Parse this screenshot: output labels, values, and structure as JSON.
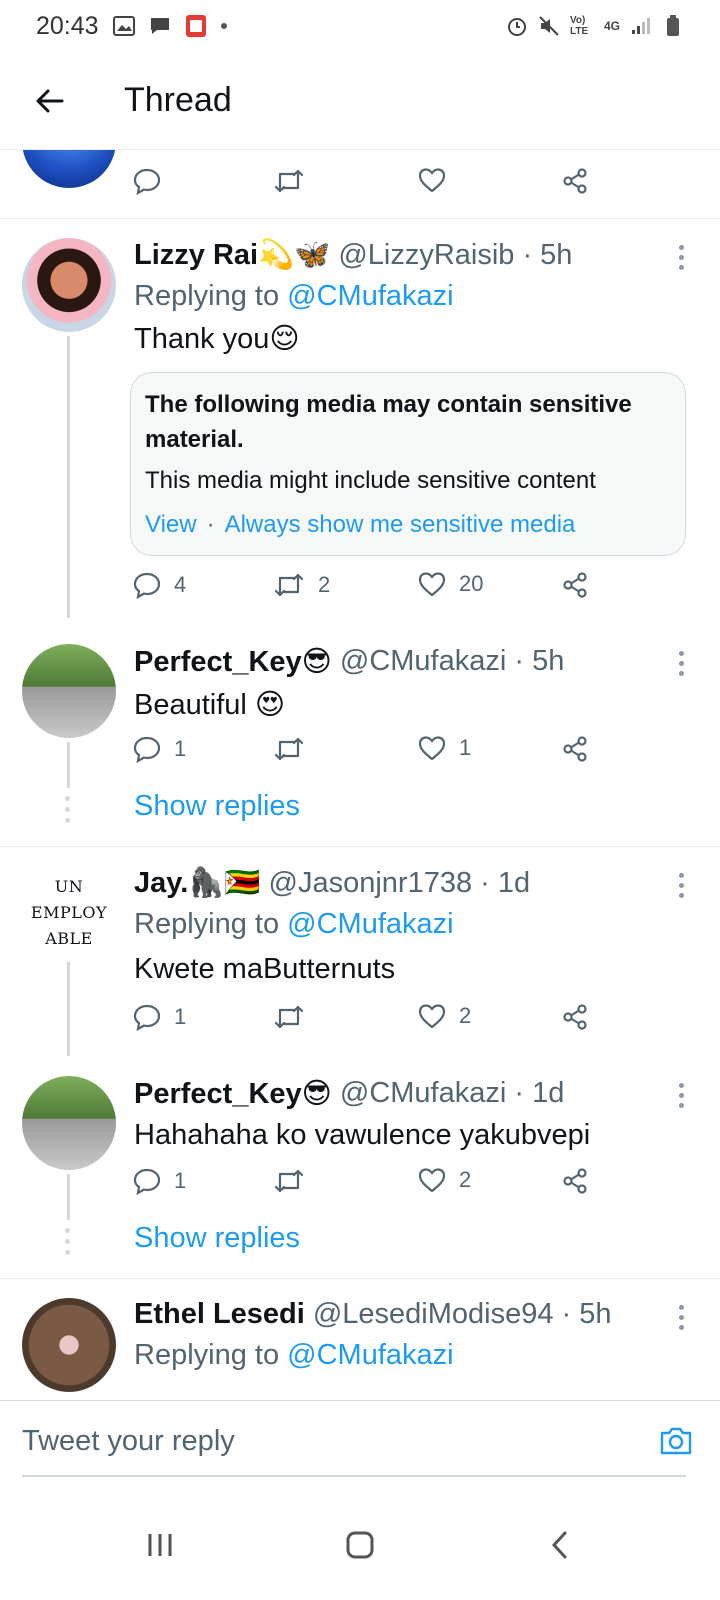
{
  "status_bar": {
    "time": "20:43",
    "network": "4G",
    "volte": "Vo) LTE"
  },
  "header": {
    "title": "Thread"
  },
  "top_actions": {
    "reply_count": "",
    "retweet_count": "",
    "like_count": ""
  },
  "tweets": [
    {
      "name": "Lizzy Rai💫🦋",
      "handle": "@LizzyRaisib · 5h",
      "replying_prefix": "Replying to",
      "replying_handle": "@CMufakazi",
      "text": "Thank you😌",
      "sensitive": {
        "title": "The following media may contain sensitive material.",
        "desc": "This media might include sensitive content",
        "view": "View",
        "sep": "·",
        "always": "Always show me sensitive media"
      },
      "reply_count": "4",
      "retweet_count": "2",
      "like_count": "20"
    },
    {
      "name": "Perfect_Key😎",
      "handle": "@CMufakazi · 5h",
      "text": "Beautiful 😍",
      "reply_count": "1",
      "retweet_count": "",
      "like_count": "1",
      "show_replies": "Show replies"
    },
    {
      "name": "Jay.🦍🇿🇼",
      "handle": "@Jasonjnr1738 · 1d",
      "replying_prefix": "Replying to",
      "replying_handle": "@CMufakazi",
      "text": "Kwete maButternuts",
      "avatar_text": [
        "UN",
        "EMPLOY",
        "ABLE"
      ],
      "reply_count": "1",
      "retweet_count": "",
      "like_count": "2"
    },
    {
      "name": "Perfect_Key😎",
      "handle": "@CMufakazi · 1d",
      "text": "Hahahaha ko vawulence yakubvepi",
      "reply_count": "1",
      "retweet_count": "",
      "like_count": "2",
      "show_replies": "Show replies"
    },
    {
      "name": "Ethel Lesedi",
      "handle": "@LesediModise94 · 5h",
      "replying_prefix": "Replying to",
      "replying_handle": "@CMufakazi"
    }
  ],
  "reply_bar": {
    "placeholder": "Tweet your reply"
  },
  "colors": {
    "accent": "#1d9bf0",
    "muted": "#536471",
    "border": "#cfd9de"
  }
}
